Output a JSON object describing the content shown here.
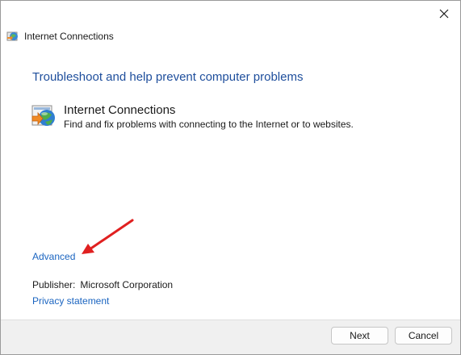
{
  "window": {
    "title": "Internet Connections",
    "title_icon": "internet-connections-icon",
    "close_icon": "close-icon"
  },
  "main": {
    "heading": "Troubleshoot and help prevent computer problems",
    "item": {
      "icon": "network-globe-icon",
      "title": "Internet Connections",
      "description": "Find and fix problems with connecting to the Internet or to websites."
    },
    "advanced_label": "Advanced",
    "annotation": "red-arrow-pointing-to-advanced",
    "publisher_label": "Publisher:",
    "publisher_value": "Microsoft Corporation",
    "privacy_label": "Privacy statement"
  },
  "footer": {
    "next_label": "Next",
    "cancel_label": "Cancel"
  },
  "colors": {
    "heading": "#1e4e9c",
    "link": "#1a64c0",
    "annotation_arrow": "#e02020",
    "footer_bg": "#f0f0f0"
  }
}
